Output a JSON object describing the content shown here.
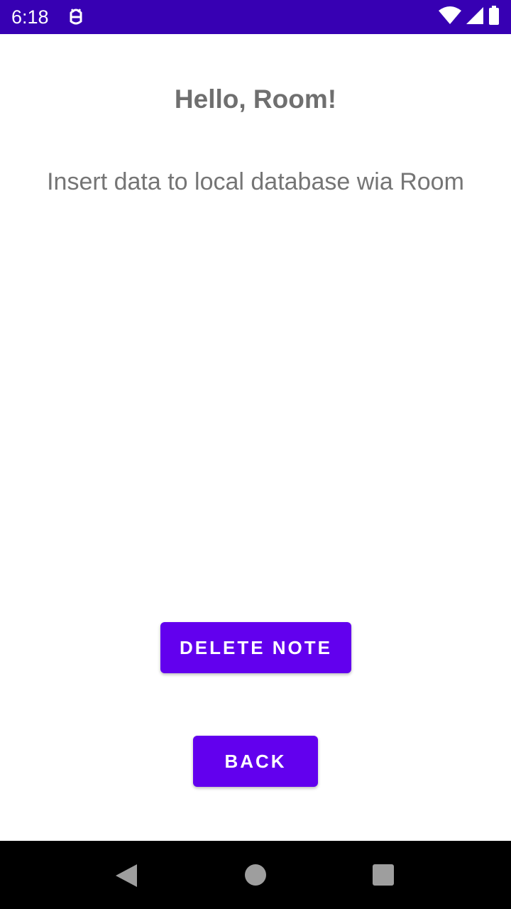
{
  "status_bar": {
    "time": "6:18",
    "background_color": "#3700b3",
    "app_icon": "android-debug-icon",
    "right_icons": [
      "wifi-icon",
      "cellular-signal-icon",
      "battery-icon"
    ]
  },
  "main": {
    "title": "Hello, Room!",
    "subtitle": "Insert data to local database wia Room",
    "delete_button_label": "DELETE NOTE",
    "back_button_label": "BACK",
    "accent_color": "#6200ee"
  },
  "nav_bar": {
    "icons": [
      "back-triangle-icon",
      "home-circle-icon",
      "recents-square-icon"
    ]
  }
}
